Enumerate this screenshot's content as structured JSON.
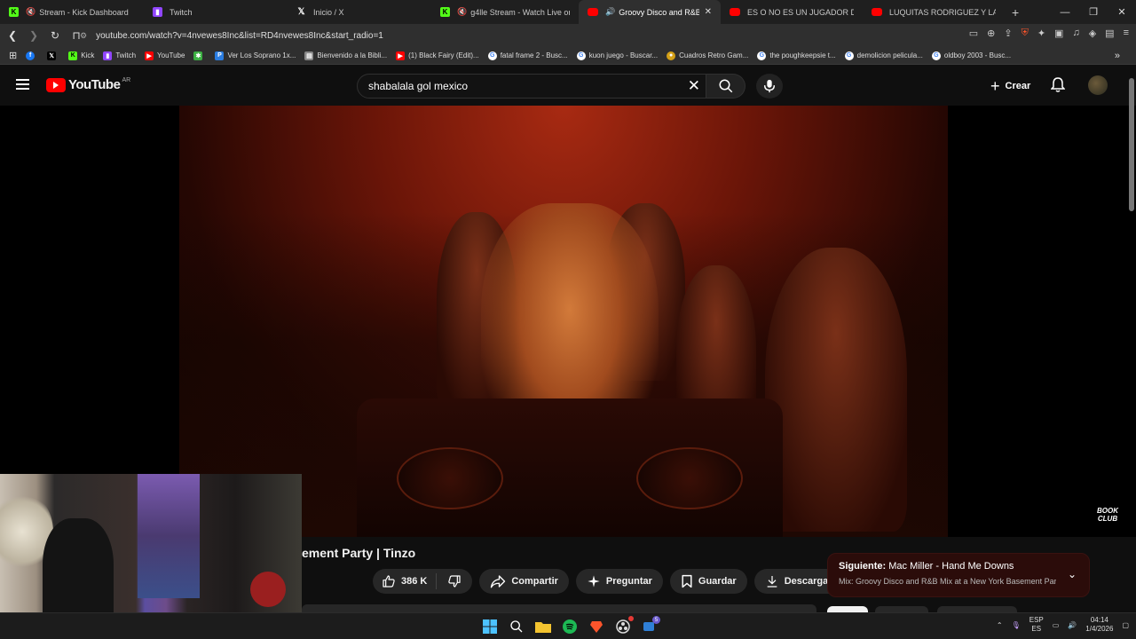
{
  "browser": {
    "tabs": [
      {
        "label": "Stream - Kick Dashboard",
        "icon": "kick-icon",
        "active": false
      },
      {
        "label": "Twitch",
        "icon": "twitch-icon",
        "active": false
      },
      {
        "label": "Inicio / X",
        "icon": "x-icon",
        "active": false
      },
      {
        "label": "g4lle Stream - Watch Live on Kick",
        "icon": "kick-icon",
        "active": false
      },
      {
        "label": "Groovy Disco and R&B Mix at a",
        "icon": "youtube-icon",
        "active": true
      },
      {
        "label": "ES O NO ES UN JUGADOR DE FÚTBOL",
        "icon": "youtube-icon",
        "active": false
      },
      {
        "label": "LUQUITAS RODRIGUEZ Y LA PEOR E",
        "icon": "youtube-icon",
        "active": false
      }
    ],
    "url": "youtube.com/watch?v=4nvewes8Inc&list=RD4nvewes8Inc&start_radio=1",
    "bookmarks": [
      {
        "label": "",
        "icon": "facebook-icon",
        "color": "#1877f2"
      },
      {
        "label": "",
        "icon": "x-icon",
        "color": "#000000"
      },
      {
        "label": "Kick",
        "icon": "kick-icon",
        "color": "#53fc18"
      },
      {
        "label": "Twitch",
        "icon": "twitch-icon",
        "color": "#9146ff"
      },
      {
        "label": "YouTube",
        "icon": "youtube-icon",
        "color": "#ff0000"
      },
      {
        "label": "",
        "icon": "extension-icon",
        "color": "#3cb043"
      },
      {
        "label": "Ver Los Soprano 1x...",
        "icon": "page-icon",
        "color": "#2a7de1"
      },
      {
        "label": "Bienvenido a la Bibli...",
        "icon": "page-icon",
        "color": "#888888"
      },
      {
        "label": "(1) Black Fairy (Edit)...",
        "icon": "youtube-icon",
        "color": "#ff0000"
      },
      {
        "label": "fatal frame 2 - Busc...",
        "icon": "google-icon",
        "color": "#ffffff"
      },
      {
        "label": "kuon juego - Buscar...",
        "icon": "google-icon",
        "color": "#ffffff"
      },
      {
        "label": "Cuadros Retro Gam...",
        "icon": "page-icon",
        "color": "#d4a017"
      },
      {
        "label": "the poughkeepsie t...",
        "icon": "google-icon",
        "color": "#ffffff"
      },
      {
        "label": "demolicion pelicula...",
        "icon": "google-icon",
        "color": "#ffffff"
      },
      {
        "label": "oldboy 2003 - Busc...",
        "icon": "google-icon",
        "color": "#ffffff"
      }
    ]
  },
  "youtube": {
    "logo_text": "YouTube",
    "country_code": "AR",
    "search_value": "shabalala gol mexico",
    "create_label": "Crear",
    "video_title": "ement Party | Tinzo",
    "watermark_line1": "BOOK",
    "watermark_line2": "CLUB",
    "like_count": "386 K",
    "share_label": "Compartir",
    "ask_label": "Preguntar",
    "save_label": "Guardar",
    "download_label": "Descargar",
    "next_prefix": "Siguiente:",
    "next_title": "Mac Miller - Hand Me Downs",
    "next_subtitle": "Mix: Groovy Disco and R&B Mix at a New York Basement Par..."
  },
  "taskbar": {
    "lang_top": "ESP",
    "lang_bottom": "ES",
    "time": "04:14",
    "date": "1/4/2026",
    "chat_badge": "5"
  },
  "colors": {
    "youtube_red": "#ff0000",
    "next_card_bg": "#2b0c0a",
    "chip_bg": "#272727"
  }
}
